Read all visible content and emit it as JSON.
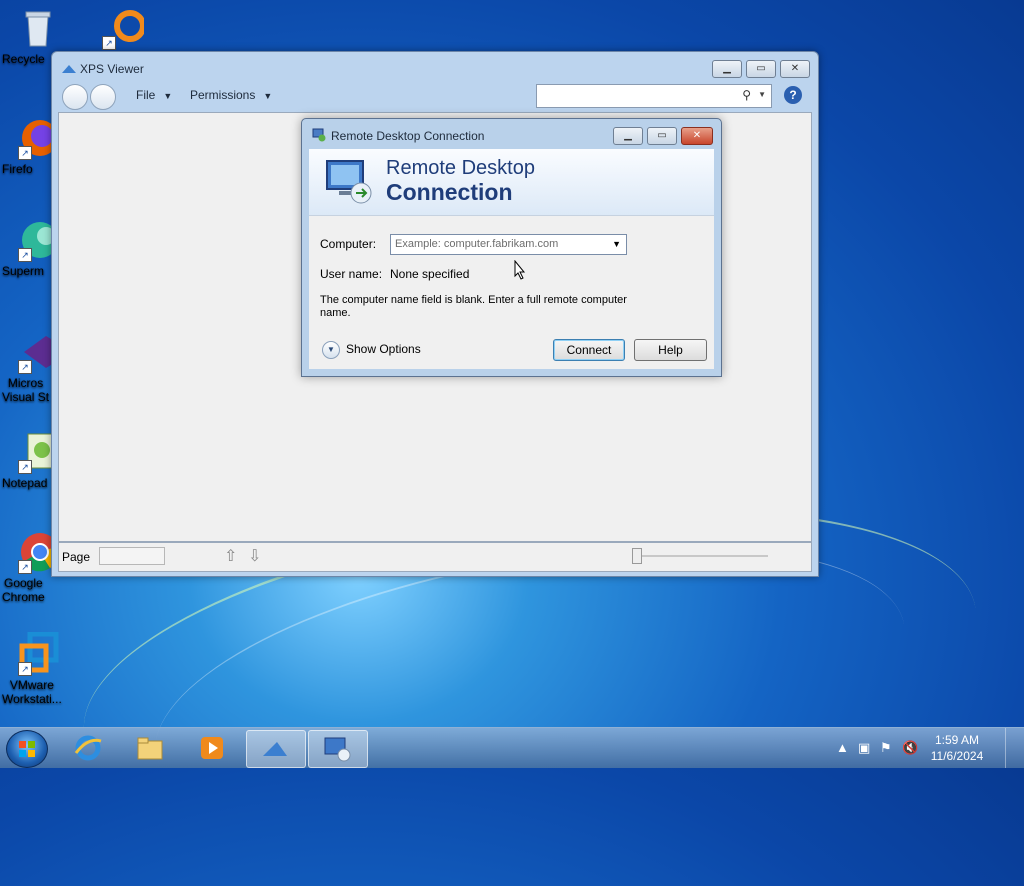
{
  "desktop": {
    "icons": [
      {
        "label": "Recycle"
      },
      {
        "label": ""
      },
      {
        "label": "Firefo"
      },
      {
        "label": "Superm"
      },
      {
        "label": "Micros\nVisual St"
      },
      {
        "label": "Notepad"
      },
      {
        "label": "Google\nChrome"
      },
      {
        "label": "VMware\nWorkstati..."
      }
    ]
  },
  "xps_viewer": {
    "title": "XPS Viewer",
    "menu": {
      "file": "File",
      "permissions": "Permissions"
    },
    "search_placeholder": "",
    "status": {
      "page_label": "Page",
      "page_value": ""
    }
  },
  "rdc": {
    "title": "Remote Desktop Connection",
    "banner_line1": "Remote Desktop",
    "banner_line2": "Connection",
    "computer_label": "Computer:",
    "computer_placeholder": "Example: computer.fabrikam.com",
    "username_label": "User name:",
    "username_value": "None specified",
    "message": "The computer name field is blank. Enter a full remote computer name.",
    "show_options": "Show Options",
    "connect": "Connect",
    "help": "Help"
  },
  "taskbar": {
    "time": "1:59 AM",
    "date": "11/6/2024"
  },
  "colors": {
    "accent": "#1f3d7a",
    "desktop": "#1464c4"
  }
}
